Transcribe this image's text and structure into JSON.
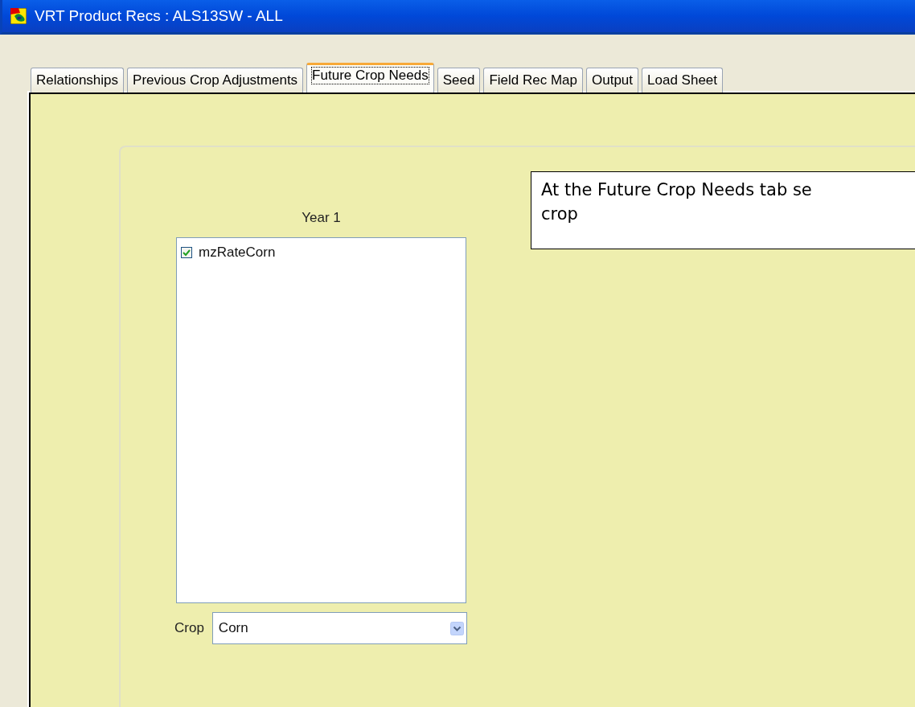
{
  "window": {
    "title": "VRT Product Recs : ALS13SW - ALL"
  },
  "tabs": [
    {
      "label": "Relationships",
      "selected": false
    },
    {
      "label": "Previous Crop Adjustments",
      "selected": false
    },
    {
      "label": "Future Crop Needs",
      "selected": true
    },
    {
      "label": "Seed",
      "selected": false
    },
    {
      "label": "Field Rec Map",
      "selected": false
    },
    {
      "label": "Output",
      "selected": false
    },
    {
      "label": "Load Sheet",
      "selected": false
    }
  ],
  "year_column": {
    "heading": "Year 1",
    "items": [
      {
        "label": "mzRateCorn",
        "checked": true
      }
    ],
    "crop": {
      "label": "Crop",
      "value": "Corn"
    }
  },
  "callout": {
    "text": "At the Future Crop Needs tab se\ncrop"
  }
}
